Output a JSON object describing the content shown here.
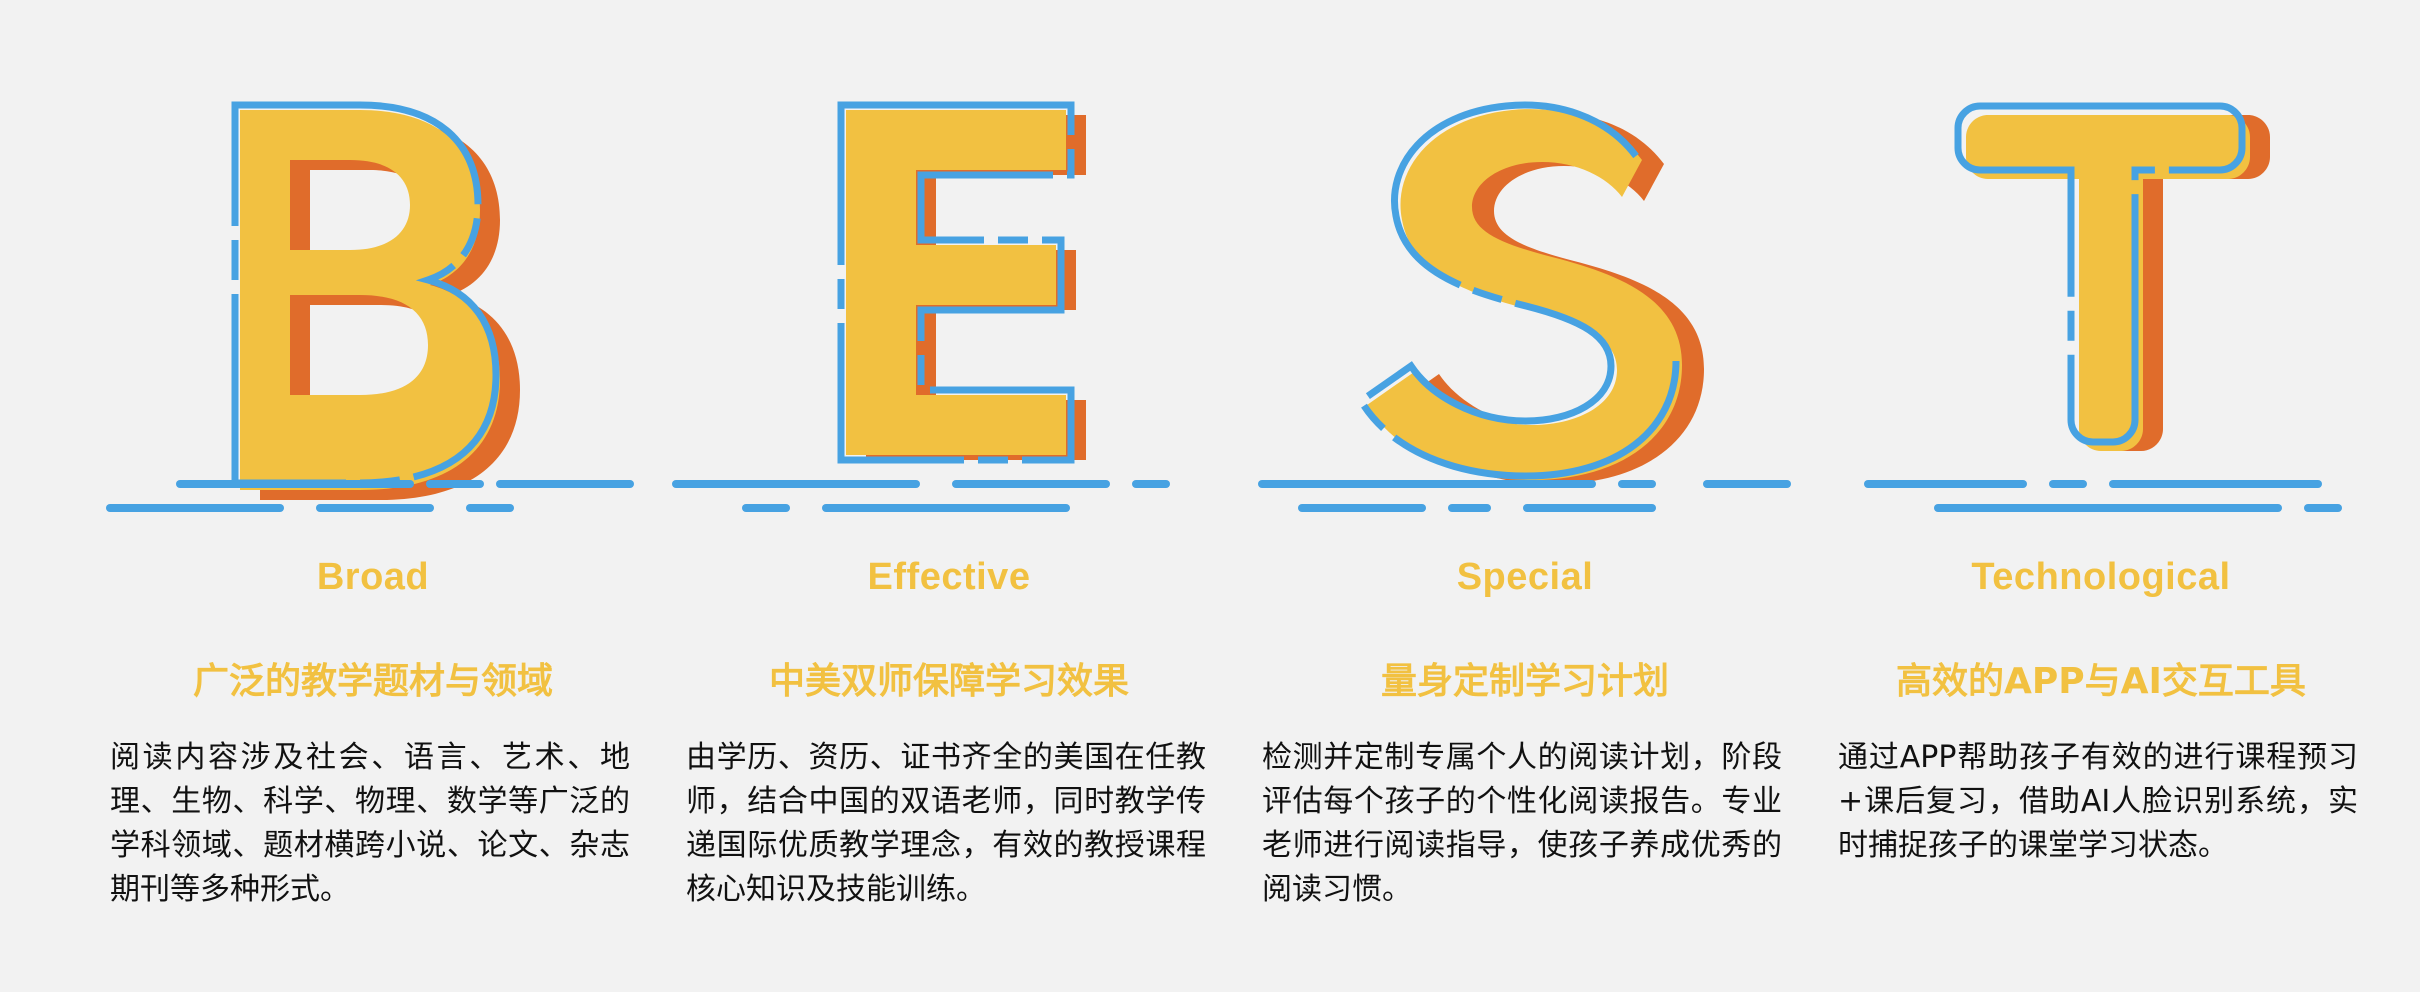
{
  "colors": {
    "background": "#f2f2f2",
    "letter_fill": "#f2c141",
    "letter_shadow": "#e06c2b",
    "letter_outline": "#47a2e2",
    "accent_text": "#f2c141",
    "body_text": "#111111"
  },
  "columns": [
    {
      "letter": "B",
      "english": "Broad",
      "chinese_title": "广泛的教学题材与领域",
      "description": "阅读内容涉及社会、语言、艺术、地理、生物、科学、物理、数学等广泛的学科领域、题材横跨小说、论文、杂志期刊等多种形式。"
    },
    {
      "letter": "E",
      "english": "Effective",
      "chinese_title": "中美双师保障学习效果",
      "description": "由学历、资历、证书齐全的美国在任教师，结合中国的双语老师，同时教学传递国际优质教学理念，有效的教授课程核心知识及技能训练。"
    },
    {
      "letter": "S",
      "english": "Special",
      "chinese_title": "量身定制学习计划",
      "description": "检测并定制专属个人的阅读计划，阶段评估每个孩子的个性化阅读报告。专业老师进行阅读指导，使孩子养成优秀的阅读习惯。"
    },
    {
      "letter": "T",
      "english": "Technological",
      "chinese_title": "高效的APP与AI交互工具",
      "description": "通过APP帮助孩子有效的进行课程预习+课后复习，借助AI人脸识别系统，实时捕捉孩子的课堂学习状态。"
    }
  ]
}
